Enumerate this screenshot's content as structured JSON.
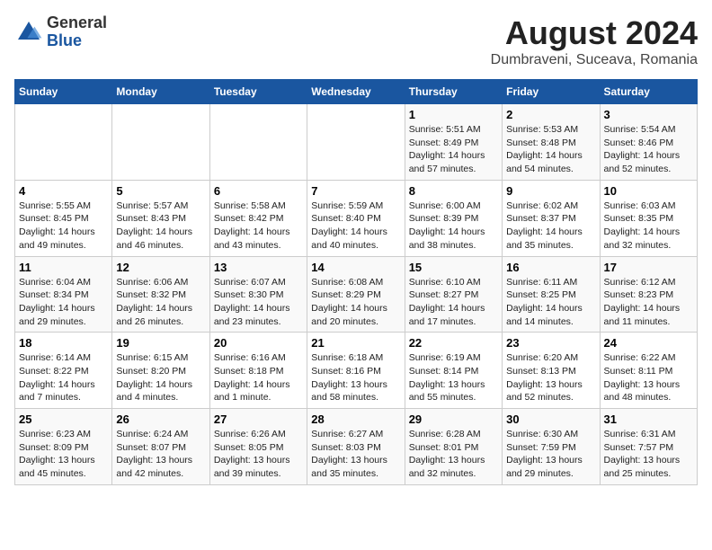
{
  "logo": {
    "general": "General",
    "blue": "Blue"
  },
  "title": "August 2024",
  "subtitle": "Dumbraveni, Suceava, Romania",
  "days_of_week": [
    "Sunday",
    "Monday",
    "Tuesday",
    "Wednesday",
    "Thursday",
    "Friday",
    "Saturday"
  ],
  "weeks": [
    [
      {
        "day": "",
        "info": ""
      },
      {
        "day": "",
        "info": ""
      },
      {
        "day": "",
        "info": ""
      },
      {
        "day": "",
        "info": ""
      },
      {
        "day": "1",
        "info": "Sunrise: 5:51 AM\nSunset: 8:49 PM\nDaylight: 14 hours and 57 minutes."
      },
      {
        "day": "2",
        "info": "Sunrise: 5:53 AM\nSunset: 8:48 PM\nDaylight: 14 hours and 54 minutes."
      },
      {
        "day": "3",
        "info": "Sunrise: 5:54 AM\nSunset: 8:46 PM\nDaylight: 14 hours and 52 minutes."
      }
    ],
    [
      {
        "day": "4",
        "info": "Sunrise: 5:55 AM\nSunset: 8:45 PM\nDaylight: 14 hours and 49 minutes."
      },
      {
        "day": "5",
        "info": "Sunrise: 5:57 AM\nSunset: 8:43 PM\nDaylight: 14 hours and 46 minutes."
      },
      {
        "day": "6",
        "info": "Sunrise: 5:58 AM\nSunset: 8:42 PM\nDaylight: 14 hours and 43 minutes."
      },
      {
        "day": "7",
        "info": "Sunrise: 5:59 AM\nSunset: 8:40 PM\nDaylight: 14 hours and 40 minutes."
      },
      {
        "day": "8",
        "info": "Sunrise: 6:00 AM\nSunset: 8:39 PM\nDaylight: 14 hours and 38 minutes."
      },
      {
        "day": "9",
        "info": "Sunrise: 6:02 AM\nSunset: 8:37 PM\nDaylight: 14 hours and 35 minutes."
      },
      {
        "day": "10",
        "info": "Sunrise: 6:03 AM\nSunset: 8:35 PM\nDaylight: 14 hours and 32 minutes."
      }
    ],
    [
      {
        "day": "11",
        "info": "Sunrise: 6:04 AM\nSunset: 8:34 PM\nDaylight: 14 hours and 29 minutes."
      },
      {
        "day": "12",
        "info": "Sunrise: 6:06 AM\nSunset: 8:32 PM\nDaylight: 14 hours and 26 minutes."
      },
      {
        "day": "13",
        "info": "Sunrise: 6:07 AM\nSunset: 8:30 PM\nDaylight: 14 hours and 23 minutes."
      },
      {
        "day": "14",
        "info": "Sunrise: 6:08 AM\nSunset: 8:29 PM\nDaylight: 14 hours and 20 minutes."
      },
      {
        "day": "15",
        "info": "Sunrise: 6:10 AM\nSunset: 8:27 PM\nDaylight: 14 hours and 17 minutes."
      },
      {
        "day": "16",
        "info": "Sunrise: 6:11 AM\nSunset: 8:25 PM\nDaylight: 14 hours and 14 minutes."
      },
      {
        "day": "17",
        "info": "Sunrise: 6:12 AM\nSunset: 8:23 PM\nDaylight: 14 hours and 11 minutes."
      }
    ],
    [
      {
        "day": "18",
        "info": "Sunrise: 6:14 AM\nSunset: 8:22 PM\nDaylight: 14 hours and 7 minutes."
      },
      {
        "day": "19",
        "info": "Sunrise: 6:15 AM\nSunset: 8:20 PM\nDaylight: 14 hours and 4 minutes."
      },
      {
        "day": "20",
        "info": "Sunrise: 6:16 AM\nSunset: 8:18 PM\nDaylight: 14 hours and 1 minute."
      },
      {
        "day": "21",
        "info": "Sunrise: 6:18 AM\nSunset: 8:16 PM\nDaylight: 13 hours and 58 minutes."
      },
      {
        "day": "22",
        "info": "Sunrise: 6:19 AM\nSunset: 8:14 PM\nDaylight: 13 hours and 55 minutes."
      },
      {
        "day": "23",
        "info": "Sunrise: 6:20 AM\nSunset: 8:13 PM\nDaylight: 13 hours and 52 minutes."
      },
      {
        "day": "24",
        "info": "Sunrise: 6:22 AM\nSunset: 8:11 PM\nDaylight: 13 hours and 48 minutes."
      }
    ],
    [
      {
        "day": "25",
        "info": "Sunrise: 6:23 AM\nSunset: 8:09 PM\nDaylight: 13 hours and 45 minutes."
      },
      {
        "day": "26",
        "info": "Sunrise: 6:24 AM\nSunset: 8:07 PM\nDaylight: 13 hours and 42 minutes."
      },
      {
        "day": "27",
        "info": "Sunrise: 6:26 AM\nSunset: 8:05 PM\nDaylight: 13 hours and 39 minutes."
      },
      {
        "day": "28",
        "info": "Sunrise: 6:27 AM\nSunset: 8:03 PM\nDaylight: 13 hours and 35 minutes."
      },
      {
        "day": "29",
        "info": "Sunrise: 6:28 AM\nSunset: 8:01 PM\nDaylight: 13 hours and 32 minutes."
      },
      {
        "day": "30",
        "info": "Sunrise: 6:30 AM\nSunset: 7:59 PM\nDaylight: 13 hours and 29 minutes."
      },
      {
        "day": "31",
        "info": "Sunrise: 6:31 AM\nSunset: 7:57 PM\nDaylight: 13 hours and 25 minutes."
      }
    ]
  ]
}
